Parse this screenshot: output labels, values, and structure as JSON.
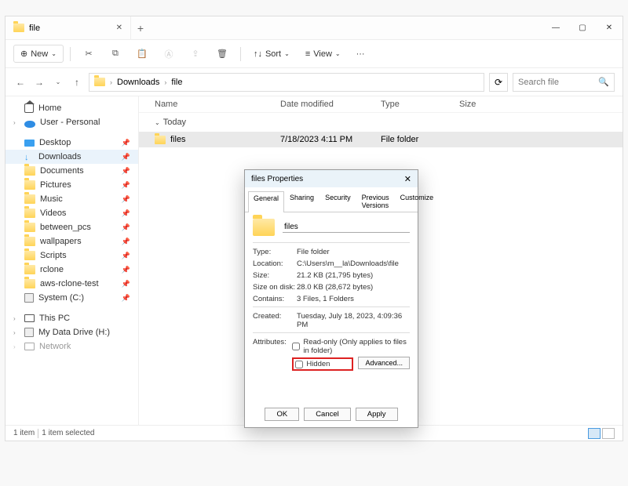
{
  "titlebar": {
    "tab": {
      "title": "file"
    },
    "new_tab": "+"
  },
  "toolbar": {
    "new_label": "New",
    "sort_label": "Sort",
    "view_label": "View",
    "more": "···"
  },
  "navbar": {
    "path_1": "Downloads",
    "path_2": "file",
    "search_placeholder": "Search file"
  },
  "sidebar": {
    "home": "Home",
    "user": "User - Personal",
    "desktop": "Desktop",
    "downloads": "Downloads",
    "documents": "Documents",
    "pictures": "Pictures",
    "music": "Music",
    "videos": "Videos",
    "between_pcs": "between_pcs",
    "wallpapers": "wallpapers",
    "scripts": "Scripts",
    "rclone": "rclone",
    "aws": "aws-rclone-test",
    "system_c": "System (C:)",
    "this_pc": "This PC",
    "my_data": "My Data Drive (H:)",
    "network": "Network"
  },
  "columns": {
    "name": "Name",
    "date": "Date modified",
    "type": "Type",
    "size": "Size"
  },
  "group": {
    "today": "Today"
  },
  "row": {
    "name": "files",
    "date": "7/18/2023 4:11 PM",
    "type": "File folder",
    "size": ""
  },
  "status": {
    "count": "1 item",
    "selected": "1 item selected"
  },
  "dialog": {
    "title": "files Properties",
    "tabs": {
      "general": "General",
      "sharing": "Sharing",
      "security": "Security",
      "prev": "Previous Versions",
      "custom": "Customize"
    },
    "name_value": "files",
    "type_label": "Type:",
    "type_value": "File folder",
    "loc_label": "Location:",
    "loc_value": "C:\\Users\\m__la\\Downloads\\file",
    "size_label": "Size:",
    "size_value": "21.2 KB (21,795 bytes)",
    "disk_label": "Size on disk:",
    "disk_value": "28.0 KB (28,672 bytes)",
    "contains_label": "Contains:",
    "contains_value": "3 Files, 1 Folders",
    "created_label": "Created:",
    "created_value": "Tuesday, July 18, 2023, 4:09:36 PM",
    "attr_label": "Attributes:",
    "readonly": "Read-only (Only applies to files in folder)",
    "hidden": "Hidden",
    "advanced": "Advanced...",
    "ok": "OK",
    "cancel": "Cancel",
    "apply": "Apply"
  }
}
